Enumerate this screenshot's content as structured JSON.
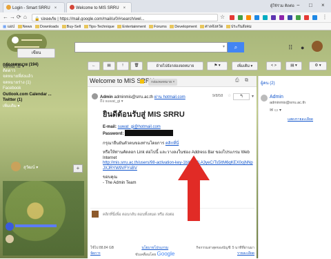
{
  "browser": {
    "tabs": [
      {
        "title": "Login - Smart SRRU",
        "close": "×"
      },
      {
        "title": "Welcome to MIS SRRU",
        "close": "×"
      }
    ],
    "window_user": "ผู้ใช้ร่วม ติดต่อ",
    "window_controls": {
      "minimize": "−",
      "maximize": "□",
      "close": "×"
    },
    "url": "ปลอดภัย | https://mail.google.com/mail/u/0/#search/wel...",
    "bookmarks": [
      "แอป",
      "News",
      "Downloads",
      "Buy-Sell",
      "Tips-Technique",
      "Entertainment",
      "Forums",
      "Development",
      "ศาลจังหวัด",
      "ประกันสังคม"
    ]
  },
  "gmail": {
    "search_icon": "search-icon",
    "mail_label": "จดหมาย ▾",
    "toolbar": {
      "back": "←",
      "archive": "▤",
      "spam": "!",
      "delete": "🗑",
      "move": "ย้ายไปยังกล่องจดหมาย",
      "labels": "▾",
      "more": "เพิ่มเติม ▾",
      "nav": "< >",
      "view": "▤ ▾",
      "settings": "⚙ ▾"
    },
    "sidebar": {
      "compose": "เขียน",
      "folders": [
        {
          "label": "กล่องจดหมาย (194)",
          "bold": true
        },
        {
          "label": "ติดดาว",
          "bold": false
        },
        {
          "label": "จดหมายที่ส่งแล้ว",
          "bold": false
        },
        {
          "label": "จดหมายร่าง (1)",
          "bold": false
        },
        {
          "label": "Facebook",
          "bold": false
        },
        {
          "label": "Outlook.com Calendar ...",
          "bold": true
        },
        {
          "label": "Twitter (1)",
          "bold": true
        },
        {
          "label": "เพิ่มเติม ▾",
          "bold": false
        }
      ],
      "hangout_user": "สุวัฒน์ ▾",
      "hangout_plus": "+"
    },
    "message": {
      "subject": "Welcome to MIS SRRU",
      "label": "กล่องจดหมาย ×",
      "sender_name": "Admin",
      "sender_email": "adminmis@srru.ac.th",
      "via": "ผ่าน hotmail.com",
      "to": "ถึง suwat_gi",
      "date": "9/8/58",
      "welcome": "ยินดีต้อนรับสู่ MIS SRRU",
      "email_label": "E-mail:",
      "email_value": "suwat_gi@hotmail.com",
      "password_label": "Password:",
      "confirm_text": "กรุณายืนยันตัวตนของท่านโดยการ",
      "confirm_link": "คลิกที่นี่",
      "copy_text": "หรือให้ท่านคัดลอก Link ต่อไปนี้ และวางลงในช่อง Address Bar ของโปรแกรม Web Internet",
      "copy_link": "http://mis.srru.ac.th/users/98-activation-key-1bXARJLA3yeC/Ts5ItM6qKEX0ojNNpJXJRYW9VFYsBV",
      "thanks": "ขอบคุณ",
      "signature": "- The Admin Team",
      "reply_prompt": "คลิกที่นี่เพื่อ ตอบกลับ ตอบทั้งหมด หรือ ส่งต่อ",
      "storage": "ใช้ไป 88.84 GB",
      "manage": "จัดการ",
      "terms": "นโยบายโปรแกรม",
      "powered": "ขับเคลื่อนโดย",
      "google": "Google",
      "activity": "กิจกรรมล่าสุดของบัญชี: 5 นาทีที่ผ่านมา",
      "details": "รายละเอียด"
    },
    "right_panel": {
      "people": "ผู้คน (2)",
      "name": "Admin",
      "email": "adminmis@srru.ac.th",
      "more": "แสดงรายละเอียด"
    }
  }
}
